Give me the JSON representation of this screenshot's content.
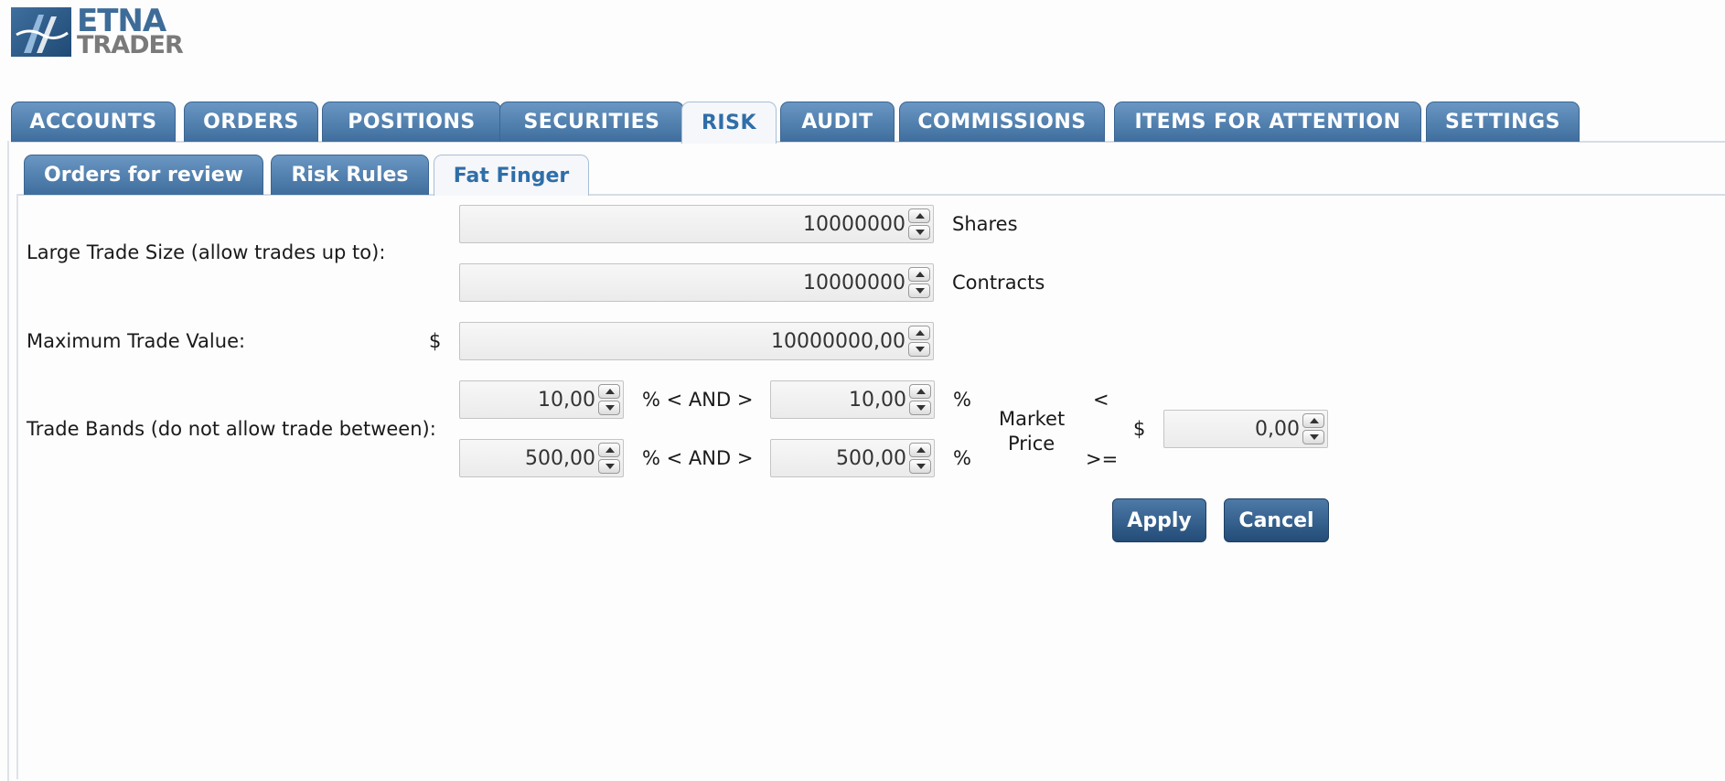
{
  "logo": {
    "line1": "ETNA",
    "line2": "TRADER"
  },
  "main_tabs": [
    {
      "label": "ACCOUNTS"
    },
    {
      "label": "ORDERS"
    },
    {
      "label": "POSITIONS"
    },
    {
      "label": "SECURITIES"
    },
    {
      "label": "RISK",
      "active": true
    },
    {
      "label": "AUDIT"
    },
    {
      "label": "COMMISSIONS"
    },
    {
      "label": "ITEMS FOR ATTENTION"
    },
    {
      "label": "SETTINGS"
    }
  ],
  "sub_tabs": [
    {
      "label": "Orders for review"
    },
    {
      "label": "Risk Rules"
    },
    {
      "label": "Fat Finger",
      "active": true
    }
  ],
  "form": {
    "large_trade": {
      "label": "Large Trade Size (allow trades up to):",
      "shares_value": "10000000",
      "shares_unit": "Shares",
      "contracts_value": "10000000",
      "contracts_unit": "Contracts"
    },
    "max_trade_value": {
      "label": "Maximum Trade Value:",
      "currency": "$",
      "value": "10000000,00"
    },
    "trade_bands": {
      "label": "Trade Bands (do not allow trade between):",
      "row1_low": "10,00",
      "row1_mid": "% < AND >",
      "row1_high": "10,00",
      "row1_pct": "%",
      "row2_low": "500,00",
      "row2_mid": "% < AND >",
      "row2_high": "500,00",
      "row2_pct": "%",
      "market_price_line1": "Market",
      "market_price_line2": "Price",
      "lt": "<",
      "gte": ">=",
      "currency": "$",
      "threshold": "0,00"
    }
  },
  "buttons": {
    "apply": "Apply",
    "cancel": "Cancel"
  },
  "colors": {
    "tab_blue": "#4a7aab",
    "active_tab_text": "#2f6ea8",
    "button_blue": "#2e5a88"
  }
}
